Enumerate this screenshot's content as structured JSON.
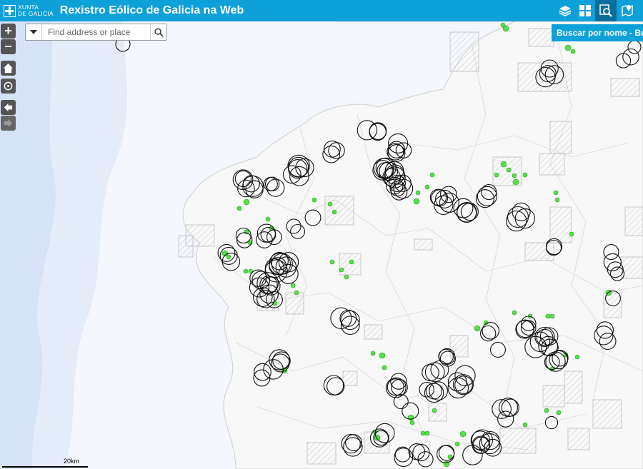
{
  "header": {
    "logo_line1": "XUNTA",
    "logo_line2": "DE GALICIA",
    "title": "Rexistro Eólico de Galicia na Web",
    "tools": [
      {
        "name": "layers-button",
        "icon": "layers-icon"
      },
      {
        "name": "basemap-gallery-button",
        "icon": "grid-icon"
      },
      {
        "name": "search-tool-button",
        "icon": "search-map-icon",
        "active": true
      },
      {
        "name": "location-tool-button",
        "icon": "map-pin-icon"
      }
    ]
  },
  "search": {
    "placeholder": "Find address or place",
    "dropdown_icon": "caret-down-icon",
    "button_icon": "magnifier-icon"
  },
  "side_tab": {
    "label": "Buscar por nome - Bu"
  },
  "nav_controls": {
    "zoom_in": "+",
    "zoom_out": "−",
    "home_icon": "home-icon",
    "locate_icon": "locate-icon",
    "back_icon": "arrow-left-icon",
    "forward_icon": "arrow-right-icon"
  },
  "scalebar": {
    "label": "20km"
  },
  "colors": {
    "header": "#0ea0d8",
    "header_active": "#0a6f98",
    "sea": "#dde7f8",
    "land": "#f7f7f7",
    "turbine_symbol": "#000000",
    "wind_farm_marker": "#55e04a"
  }
}
